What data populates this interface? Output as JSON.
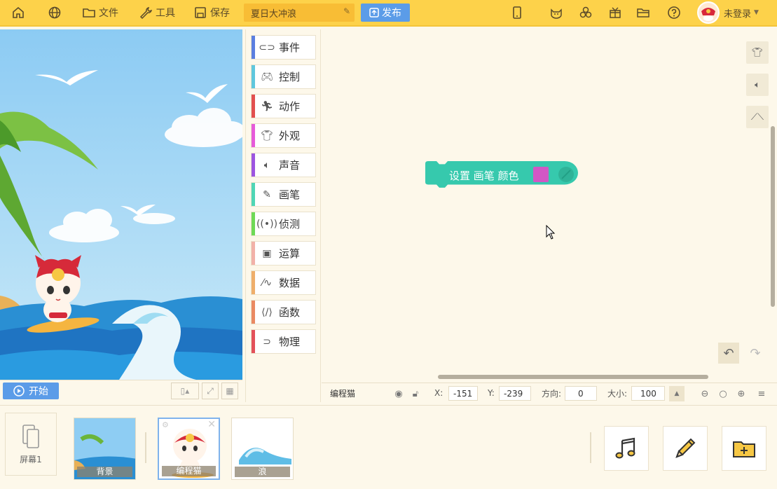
{
  "topbar": {
    "file": "文件",
    "tools": "工具",
    "save": "保存",
    "project_name": "夏日大冲浪",
    "publish": "发布",
    "login": "未登录"
  },
  "stage": {
    "start": "开始"
  },
  "categories": [
    {
      "label": "事件",
      "color": "#5b7fe0",
      "icon": "toggle-icon"
    },
    {
      "label": "控制",
      "color": "#5fc7dd",
      "icon": "gamepad-icon"
    },
    {
      "label": "动作",
      "color": "#e2504f",
      "icon": "running-icon"
    },
    {
      "label": "外观",
      "color": "#e65bd9",
      "icon": "shirt-icon"
    },
    {
      "label": "声音",
      "color": "#9d55e0",
      "icon": "speaker-icon"
    },
    {
      "label": "画笔",
      "color": "#4fd6b5",
      "icon": "pencil-icon"
    },
    {
      "label": "侦测",
      "color": "#6ed956",
      "icon": "signal-icon"
    },
    {
      "label": "运算",
      "color": "#f2b1a8",
      "icon": "calculator-icon"
    },
    {
      "label": "数据",
      "color": "#efae6a",
      "icon": "chart-line-icon"
    },
    {
      "label": "函数",
      "color": "#ea8a62",
      "icon": "code-icon"
    },
    {
      "label": "物理",
      "color": "#e3515a",
      "icon": "magnet-icon"
    }
  ],
  "block": {
    "text": "设置 画笔 颜色",
    "color": "#36c9ad",
    "swatch": "#d257c5"
  },
  "props": {
    "sprite_name": "编程猫",
    "x_label": "X:",
    "x": "-151",
    "y_label": "Y:",
    "y": "-239",
    "dir_label": "方向:",
    "dir": "0",
    "size_label": "大小:",
    "size": "100"
  },
  "bottom": {
    "screen": "屏幕1",
    "sprites": [
      "背景",
      "编程猫",
      "浪"
    ]
  }
}
